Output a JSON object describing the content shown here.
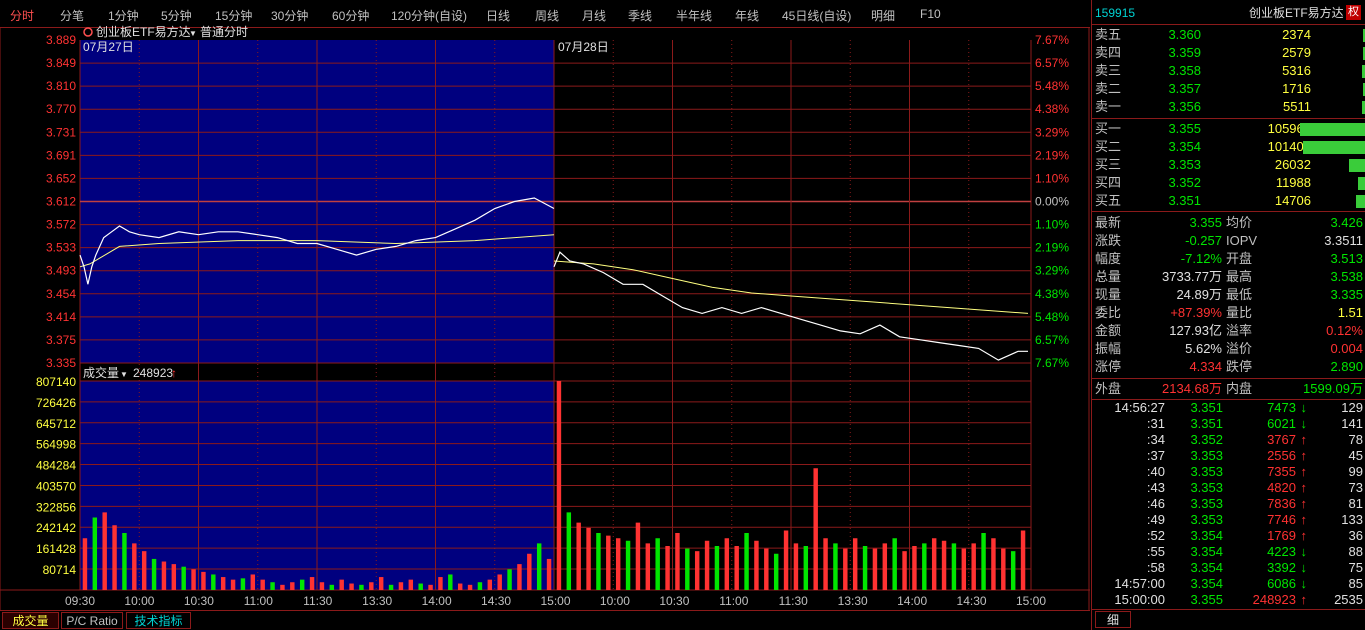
{
  "periods": [
    "分时",
    "分笔",
    "1分钟",
    "5分钟",
    "15分钟",
    "30分钟",
    "60分钟",
    "120分钟(自设)",
    "日线",
    "周线",
    "月线",
    "季线",
    "半年线",
    "年线",
    "45日线(自设)",
    "明细",
    "F10"
  ],
  "active_period": "分时",
  "chart_header": {
    "title": "创业板ETF易方达",
    "mode": "普通分时",
    "day1": "07月27日",
    "day2": "07月28日"
  },
  "volume_header": {
    "label": "成交量",
    "value": "248923"
  },
  "bottom_tabs": [
    "成交量",
    "P/C Ratio",
    "技术指标"
  ],
  "right_tab": "细",
  "colors": {
    "bg": "#000000",
    "grid": "#8b1a1a",
    "navy": "#00007f",
    "price_line": "#ffffff",
    "avg_line": "#ffff80",
    "up": "#ff3232",
    "down": "#00e600"
  },
  "chart_data": {
    "type": "line",
    "price_ticks": [
      "3.889",
      "3.849",
      "3.810",
      "3.770",
      "3.731",
      "3.691",
      "3.652",
      "3.612",
      "3.572",
      "3.533",
      "3.493",
      "3.454",
      "3.414",
      "3.375",
      "3.335"
    ],
    "pct_ticks": [
      "7.67%",
      "6.57%",
      "5.48%",
      "4.38%",
      "3.29%",
      "2.19%",
      "1.10%",
      "0.00%",
      "1.10%",
      "2.19%",
      "3.29%",
      "4.38%",
      "5.48%",
      "6.57%",
      "7.67%"
    ],
    "volume_ticks": [
      "807140",
      "726426",
      "645712",
      "564998",
      "484284",
      "403570",
      "322856",
      "242142",
      "161428",
      "80714"
    ],
    "time_ticks": [
      "09:30",
      "10:00",
      "10:30",
      "11:00",
      "11:30",
      "13:30",
      "14:00",
      "14:30",
      "15:00",
      "10:00",
      "10:30",
      "11:00",
      "11:30",
      "13:30",
      "14:00",
      "14:30",
      "15:00"
    ],
    "ylim": [
      3.335,
      3.889
    ],
    "prev_close": 3.612,
    "price_day1": [
      [
        0,
        3.52
      ],
      [
        2,
        3.5
      ],
      [
        4,
        3.47
      ],
      [
        6,
        3.5
      ],
      [
        8,
        3.52
      ],
      [
        12,
        3.55
      ],
      [
        16,
        3.56
      ],
      [
        20,
        3.57
      ],
      [
        25,
        3.56
      ],
      [
        30,
        3.555
      ],
      [
        40,
        3.55
      ],
      [
        50,
        3.56
      ],
      [
        60,
        3.555
      ],
      [
        70,
        3.56
      ],
      [
        80,
        3.56
      ],
      [
        90,
        3.555
      ],
      [
        100,
        3.55
      ],
      [
        110,
        3.54
      ],
      [
        120,
        3.54
      ],
      [
        130,
        3.53
      ],
      [
        140,
        3.52
      ],
      [
        150,
        3.53
      ],
      [
        160,
        3.535
      ],
      [
        170,
        3.545
      ],
      [
        180,
        3.55
      ],
      [
        190,
        3.565
      ],
      [
        200,
        3.58
      ],
      [
        210,
        3.6
      ],
      [
        220,
        3.612
      ],
      [
        230,
        3.618
      ],
      [
        240,
        3.6
      ]
    ],
    "avg_day1": [
      [
        0,
        3.5
      ],
      [
        5,
        3.505
      ],
      [
        10,
        3.515
      ],
      [
        20,
        3.535
      ],
      [
        40,
        3.54
      ],
      [
        80,
        3.545
      ],
      [
        120,
        3.545
      ],
      [
        160,
        3.54
      ],
      [
        200,
        3.545
      ],
      [
        240,
        3.555
      ]
    ],
    "price_day2": [
      [
        0,
        3.5
      ],
      [
        3,
        3.525
      ],
      [
        8,
        3.51
      ],
      [
        15,
        3.505
      ],
      [
        25,
        3.49
      ],
      [
        35,
        3.47
      ],
      [
        45,
        3.47
      ],
      [
        55,
        3.45
      ],
      [
        65,
        3.43
      ],
      [
        75,
        3.42
      ],
      [
        85,
        3.43
      ],
      [
        95,
        3.42
      ],
      [
        105,
        3.43
      ],
      [
        115,
        3.42
      ],
      [
        125,
        3.41
      ],
      [
        135,
        3.4
      ],
      [
        145,
        3.39
      ],
      [
        155,
        3.385
      ],
      [
        165,
        3.4
      ],
      [
        175,
        3.38
      ],
      [
        185,
        3.375
      ],
      [
        195,
        3.37
      ],
      [
        205,
        3.365
      ],
      [
        215,
        3.36
      ],
      [
        225,
        3.34
      ],
      [
        235,
        3.355
      ],
      [
        240,
        3.355
      ]
    ],
    "avg_day2": [
      [
        0,
        3.51
      ],
      [
        20,
        3.505
      ],
      [
        40,
        3.495
      ],
      [
        60,
        3.48
      ],
      [
        80,
        3.465
      ],
      [
        100,
        3.455
      ],
      [
        120,
        3.45
      ],
      [
        160,
        3.44
      ],
      [
        200,
        3.43
      ],
      [
        240,
        3.42
      ]
    ],
    "volume_day1": [
      200000,
      280000,
      300000,
      250000,
      220000,
      180000,
      150000,
      120000,
      110000,
      100000,
      90000,
      80000,
      70000,
      60000,
      50000,
      40000,
      45000,
      60000,
      40000,
      30000,
      20000,
      30000,
      40000,
      50000,
      30000,
      20000,
      40000,
      25000,
      20000,
      30000,
      50000,
      20000,
      30000,
      40000,
      25000,
      20000,
      50000,
      60000,
      25000,
      20000,
      30000,
      40000,
      60000,
      80000,
      100000,
      140000,
      180000,
      120000
    ],
    "volume_day2": [
      807140,
      300000,
      260000,
      240000,
      220000,
      210000,
      200000,
      190000,
      260000,
      180000,
      200000,
      170000,
      220000,
      160000,
      150000,
      190000,
      170000,
      200000,
      170000,
      220000,
      190000,
      160000,
      140000,
      230000,
      180000,
      170000,
      470000,
      200000,
      180000,
      160000,
      200000,
      170000,
      160000,
      180000,
      200000,
      150000,
      170000,
      180000,
      200000,
      190000,
      180000,
      160000,
      180000,
      220000,
      200000,
      160000,
      150000,
      230000
    ]
  },
  "panel": {
    "code": "159915",
    "name": "创业板ETF易方达",
    "badge": "权",
    "sell": [
      {
        "label": "卖五",
        "price": "3.360",
        "vol": "2374",
        "bar": 0.022
      },
      {
        "label": "卖四",
        "price": "3.359",
        "vol": "2579",
        "bar": 0.024
      },
      {
        "label": "卖三",
        "price": "3.358",
        "vol": "5316",
        "bar": 0.05
      },
      {
        "label": "卖二",
        "price": "3.357",
        "vol": "1716",
        "bar": 0.016
      },
      {
        "label": "卖一",
        "price": "3.356",
        "vol": "5511",
        "bar": 0.052
      }
    ],
    "buy": [
      {
        "label": "买一",
        "price": "3.355",
        "vol": "105960",
        "bar": 1.0
      },
      {
        "label": "买二",
        "price": "3.354",
        "vol": "101405",
        "bar": 0.957
      },
      {
        "label": "买三",
        "price": "3.353",
        "vol": "26032",
        "bar": 0.246
      },
      {
        "label": "买四",
        "price": "3.352",
        "vol": "11988",
        "bar": 0.113
      },
      {
        "label": "买五",
        "price": "3.351",
        "vol": "14706",
        "bar": 0.139
      }
    ],
    "stats": [
      {
        "l1": "最新",
        "v1": "3.355",
        "c1": "green",
        "l2": "均价",
        "v2": "3.426",
        "c2": "green"
      },
      {
        "l1": "涨跌",
        "v1": "-0.257",
        "c1": "green",
        "l2": "IOPV",
        "v2": "3.3511",
        "c2": "white"
      },
      {
        "l1": "幅度",
        "v1": "-7.12%",
        "c1": "green",
        "l2": "开盘",
        "v2": "3.513",
        "c2": "green"
      },
      {
        "l1": "总量",
        "v1": "3733.77万",
        "c1": "white",
        "l2": "最高",
        "v2": "3.538",
        "c2": "green"
      },
      {
        "l1": "现量",
        "v1": "24.89万",
        "c1": "white",
        "l2": "最低",
        "v2": "3.335",
        "c2": "green"
      },
      {
        "l1": "委比",
        "v1": "+87.39%",
        "c1": "red",
        "l2": "量比",
        "v2": "1.51",
        "c2": "yellow"
      },
      {
        "l1": "金额",
        "v1": "127.93亿",
        "c1": "white",
        "l2": "溢率",
        "v2": "0.12%",
        "c2": "red"
      },
      {
        "l1": "振幅",
        "v1": "5.62%",
        "c1": "white",
        "l2": "溢价",
        "v2": "0.004",
        "c2": "red"
      },
      {
        "l1": "涨停",
        "v1": "4.334",
        "c1": "red",
        "l2": "跌停",
        "v2": "2.890",
        "c2": "green"
      }
    ],
    "outer_label": "外盘",
    "outer_value": "2134.68万",
    "inner_label": "内盘",
    "inner_value": "1599.09万",
    "ticks": [
      {
        "time": "14:56:27",
        "price": "3.351",
        "vol": "7473",
        "dir": "down",
        "n": "129"
      },
      {
        "time": ":31",
        "price": "3.351",
        "vol": "6021",
        "dir": "down",
        "n": "141"
      },
      {
        "time": ":34",
        "price": "3.352",
        "vol": "3767",
        "dir": "up",
        "n": "78"
      },
      {
        "time": ":37",
        "price": "3.353",
        "vol": "2556",
        "dir": "up",
        "n": "45"
      },
      {
        "time": ":40",
        "price": "3.353",
        "vol": "7355",
        "dir": "up",
        "n": "99"
      },
      {
        "time": ":43",
        "price": "3.353",
        "vol": "4820",
        "dir": "up",
        "n": "73"
      },
      {
        "time": ":46",
        "price": "3.353",
        "vol": "7836",
        "dir": "up",
        "n": "81"
      },
      {
        "time": ":49",
        "price": "3.353",
        "vol": "7746",
        "dir": "up",
        "n": "133"
      },
      {
        "time": ":52",
        "price": "3.354",
        "vol": "1769",
        "dir": "up",
        "n": "36"
      },
      {
        "time": ":55",
        "price": "3.354",
        "vol": "4223",
        "dir": "down",
        "n": "88"
      },
      {
        "time": ":58",
        "price": "3.354",
        "vol": "3392",
        "dir": "down",
        "n": "75"
      },
      {
        "time": "14:57:00",
        "price": "3.354",
        "vol": "6086",
        "dir": "down",
        "n": "85"
      },
      {
        "time": "15:00:00",
        "price": "3.355",
        "vol": "248923",
        "dir": "up",
        "n": "2535"
      }
    ]
  }
}
